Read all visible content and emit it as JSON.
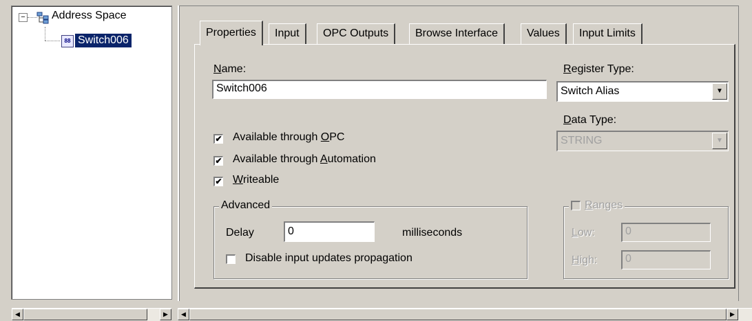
{
  "tree": {
    "root_label": "Address Space",
    "root_expander": "−",
    "selected_label": "Switch006",
    "node_icon": "register-icon",
    "node_icon_text": "88"
  },
  "tabs": [
    {
      "label": "Properties",
      "active": true
    },
    {
      "label": "Input"
    },
    {
      "label": "OPC Outputs"
    },
    {
      "label": "Browse Interface"
    },
    {
      "label": "Values"
    },
    {
      "label": "Input Limits"
    }
  ],
  "properties": {
    "name_label": "Name:",
    "name_value": "Switch006",
    "register_type_label": "Register Type:",
    "register_type_value": "Switch Alias",
    "data_type_label": "Data Type:",
    "data_type_value": "STRING",
    "available_opc_label": "Available through OPC",
    "available_opc_checked": true,
    "available_automation_label": "Available through Automation",
    "available_automation_checked": true,
    "writeable_label": "Writeable",
    "writeable_checked": true,
    "advanced_title": "Advanced",
    "delay_label": "Delay",
    "delay_value": "0",
    "delay_units": "milliseconds",
    "disable_propagation_label": "Disable input updates propagation",
    "disable_propagation_checked": false,
    "ranges_title": "Ranges",
    "ranges_checked": false,
    "low_label": "Low:",
    "low_value": "0",
    "high_label": "High:",
    "high_value": "0"
  },
  "glyphs": {
    "check": "✔",
    "dropdown": "▼",
    "left": "◀",
    "right": "▶"
  },
  "colors": {
    "window_bg": "#d4d0c8",
    "selection_bg": "#0a246a",
    "disabled_text": "#a0a0a0"
  }
}
